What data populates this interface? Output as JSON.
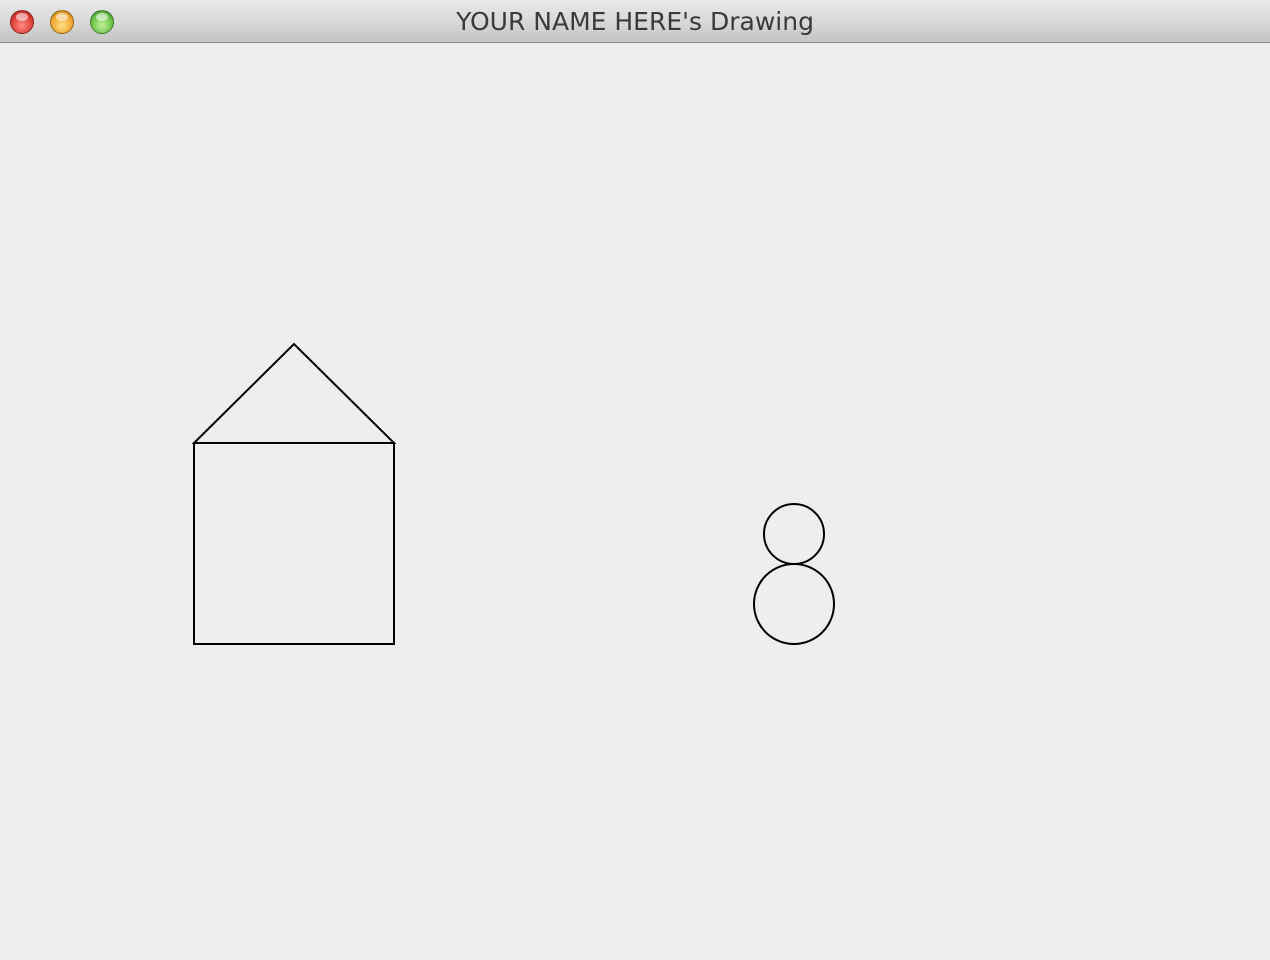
{
  "window": {
    "title": "YOUR NAME HERE's Drawing",
    "controls": {
      "close_color": "#e0423a",
      "minimize_color": "#f0a931",
      "maximize_color": "#6fc44a"
    }
  },
  "canvas": {
    "background_color": "#eeeeee",
    "stroke_color": "#000000",
    "shapes": [
      "house-roof-triangle",
      "house-body-square",
      "snowman-head-circle",
      "snowman-body-circle"
    ]
  }
}
